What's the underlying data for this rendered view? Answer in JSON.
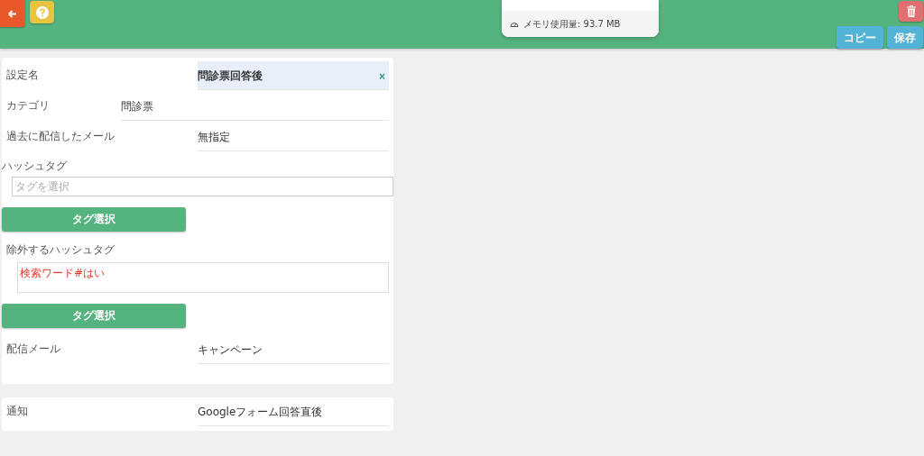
{
  "header": {
    "memory_popup": {
      "text": "メモリ使用量: 93.7 MB"
    },
    "buttons": [
      {
        "label": "コピー"
      },
      {
        "label": "保存"
      }
    ]
  },
  "form": {
    "setting_name": {
      "label": "設定名",
      "value": "問診票回答後",
      "clear": "×"
    },
    "category": {
      "label": "カテゴリ",
      "value": "問診票"
    },
    "past_mail": {
      "label": "過去に配信したメール",
      "value": "無指定"
    },
    "hashtags": {
      "label": "ハッシュタグ",
      "placeholder": "タグを選択",
      "button": "タグ選択"
    },
    "exclude_hashtags": {
      "label": "除外するハッシュタグ",
      "value": "検索ワード#はい",
      "button": "タグ選択"
    },
    "delivery_mail": {
      "label": "配信メール",
      "value": "キャンペーン"
    }
  },
  "notification": {
    "label": "通知",
    "value": "Googleフォーム回答直後"
  }
}
